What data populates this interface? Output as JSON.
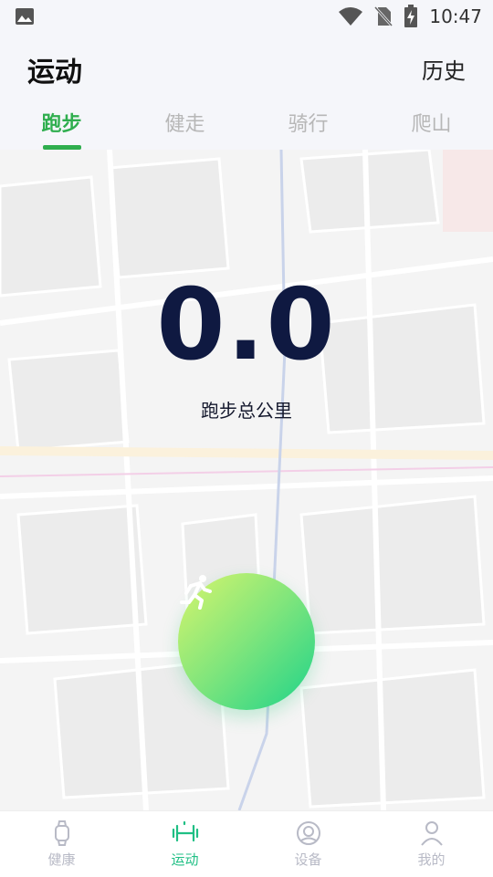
{
  "status_bar": {
    "time": "10:47",
    "icons": [
      "image-icon",
      "wifi-icon",
      "no-sim-icon",
      "battery-charging-icon"
    ]
  },
  "header": {
    "title": "运动",
    "history_label": "历史"
  },
  "tabs": [
    {
      "label": "跑步",
      "active": true
    },
    {
      "label": "健走",
      "active": false
    },
    {
      "label": "骑行",
      "active": false
    },
    {
      "label": "爬山",
      "active": false
    }
  ],
  "stats": {
    "total_value": "0.0",
    "total_label": "跑步总公里"
  },
  "start_button": {
    "icon": "running-person-icon"
  },
  "bottom_nav": [
    {
      "label": "健康",
      "icon": "watch-icon",
      "active": false
    },
    {
      "label": "运动",
      "icon": "dumbbell-icon",
      "active": true
    },
    {
      "label": "设备",
      "icon": "device-icon",
      "active": false
    },
    {
      "label": "我的",
      "icon": "person-icon",
      "active": false
    }
  ],
  "colors": {
    "accent_green": "#2fae4e",
    "nav_active": "#1fbf84",
    "number_navy": "#0f1941"
  }
}
